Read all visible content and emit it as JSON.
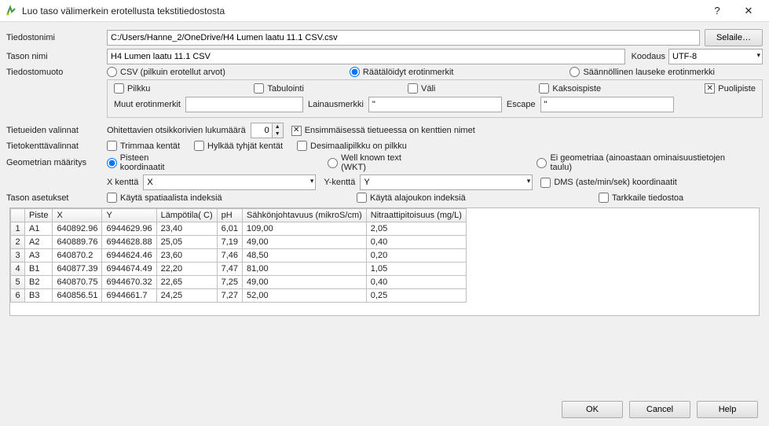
{
  "window": {
    "title": "Luo taso välimerkein erotellusta tekstitiedostosta"
  },
  "filename": {
    "label": "Tiedostonimi",
    "value": "C:/Users/Hanne_2/OneDrive/H4 Lumen laatu 11.1 CSV.csv",
    "browse": "Selaile…"
  },
  "layername": {
    "label": "Tason nimi",
    "value": "H4 Lumen laatu 11.1 CSV",
    "encoding_label": "Koodaus",
    "encoding_value": "UTF-8"
  },
  "format": {
    "label": "Tiedostomuoto",
    "csv": "CSV (pilkuin erotellut arvot)",
    "custom": "Räätälöidyt erotinmerkit",
    "regex": "Säännöllinen lauseke erotinmerkki"
  },
  "delims": {
    "comma": "Pilkku",
    "tab": "Tabulointi",
    "space": "Väli",
    "colon": "Kaksoispiste",
    "semicolon": "Puolipiste"
  },
  "other": {
    "label": "Muut erotinmerkit",
    "value": "",
    "quote_label": "Lainausmerkki",
    "quote_value": "\"",
    "escape_label": "Escape",
    "escape_value": "\""
  },
  "records": {
    "label": "Tietueiden valinnat",
    "skip_label": "Ohitettavien otsikkorivien lukumäärä",
    "skip_value": "0",
    "first_has_names": "Ensimmäisessä tietueessa on kenttien nimet"
  },
  "fields": {
    "label": "Tietokenttävalinnat",
    "trim": "Trimmaa kentät",
    "discard": "Hylkää tyhjät kentät",
    "comma_decimal": "Desimaalipilkku on pilkku"
  },
  "geometry": {
    "label": "Geometrian määritys",
    "point": "Pisteen koordinaatit",
    "wkt": "Well known text (WKT)",
    "none": "Ei geometriaa (ainoastaan ominaisuustietojen taulu)",
    "xfield_label": "X kenttä",
    "xfield_value": "X",
    "yfield_label": "Y-kenttä",
    "yfield_value": "Y",
    "dms": "DMS (aste/min/sek) koordinaatit"
  },
  "layer": {
    "label": "Tason asetukset",
    "spatial": "Käytä spatiaalista indeksiä",
    "subset": "Käytä alajoukon indeksiä",
    "watch": "Tarkkaile tiedostoa"
  },
  "table": {
    "headers": [
      "",
      "Piste",
      "X",
      "Y",
      "Lämpötila( C)",
      "pH",
      "Sähkönjohtavuus (mikroS/cm)",
      "Nitraattipitoisuus (mg/L)"
    ],
    "rows": [
      [
        "1",
        "A1",
        "640892.96",
        "6944629.96",
        "23,40",
        "6,01",
        "109,00",
        "2,05"
      ],
      [
        "2",
        "A2",
        "640889.76",
        "6944628.88",
        "25,05",
        "7,19",
        "49,00",
        "0,40"
      ],
      [
        "3",
        "A3",
        "640870.2",
        "6944624.46",
        "23,60",
        "7,46",
        "48,50",
        "0,20"
      ],
      [
        "4",
        "B1",
        "640877.39",
        "6944674.49",
        "22,20",
        "7,47",
        "81,00",
        "1,05"
      ],
      [
        "5",
        "B2",
        "640870.75",
        "6944670.32",
        "22,65",
        "7,25",
        "49,00",
        "0,40"
      ],
      [
        "6",
        "B3",
        "640856.51",
        "6944661.7",
        "24,25",
        "7,27",
        "52,00",
        "0,25"
      ]
    ]
  },
  "buttons": {
    "ok": "OK",
    "cancel": "Cancel",
    "help": "Help"
  }
}
